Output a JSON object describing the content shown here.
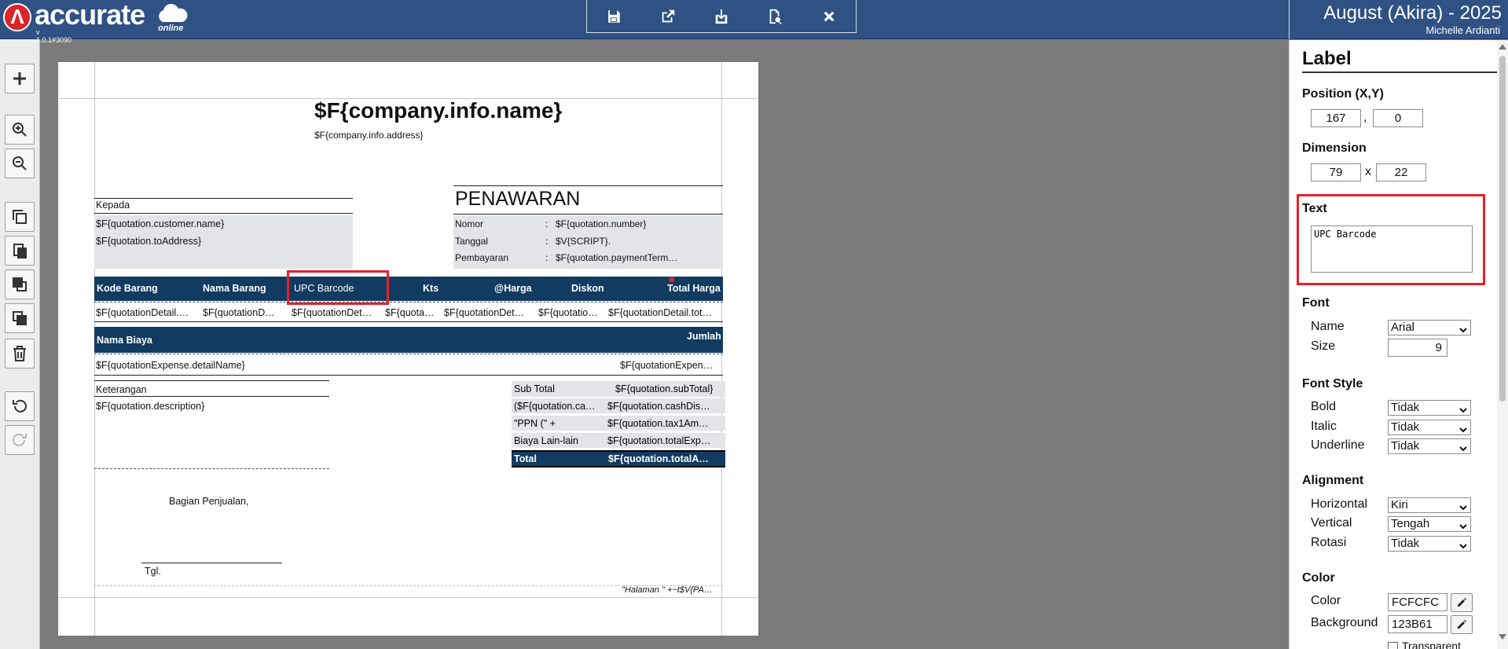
{
  "header": {
    "logo_text": "accurate",
    "logo_online": "online",
    "logo_version": "v 1.0.1#3090",
    "period_title": "August (Akira) - 2025",
    "user_name": "Michelle Ardianti"
  },
  "toolbar_top": {
    "icons": [
      "save-icon",
      "export-icon",
      "import-icon",
      "preview-icon",
      "close-icon"
    ]
  },
  "left_toolbar": {
    "icons": [
      "add-icon",
      "zoom-in-icon",
      "zoom-out-icon",
      "copy-icon",
      "paste-icon",
      "bring-front-icon",
      "send-back-icon",
      "delete-icon",
      "undo-icon",
      "redo-icon"
    ]
  },
  "report": {
    "company_name": "$F{company.info.name}",
    "company_address": "$F{company.info.address}",
    "kepada_label": "Kepada",
    "customer_name": "$F{quotation.customer.name}",
    "to_address": "$F{quotation.toAddress}",
    "doc_title": "PENAWARAN",
    "nomor_label": "Nomor",
    "nomor_value": "$F{quotation.number}",
    "tanggal_label": "Tanggal",
    "tanggal_value": "$V{SCRIPT}.",
    "pembayaran_label": "Pembayaran",
    "pembayaran_value": "$F{quotation.paymentTerm…",
    "colon": ":",
    "item_headers": [
      "Kode Barang",
      "Nama Barang",
      "UPC Barcode",
      "Kts",
      "@Harga",
      "Diskon",
      "Total Harga"
    ],
    "item_cells": [
      "$F{quotationDetail.…",
      "$F{quotationD…",
      "$F{quotationDet…",
      "$F{quota…",
      "$F{quotationDet…",
      "$F{quotatio…",
      "$F{quotationDetail.tot…"
    ],
    "expense_header": "Nama Biaya",
    "expense_amount_header": "Jumlah",
    "expense_name": "$F{quotationExpense.detailName}",
    "expense_amount": "$F{quotationExpen…",
    "keterangan_label": "Keterangan",
    "description": "$F{quotation.description}",
    "summary": [
      {
        "label": "Sub Total",
        "value": "$F{quotation.subTotal}"
      },
      {
        "label": "($F{quotation.ca…",
        "value": "$F{quotation.cashDis…"
      },
      {
        "label": "\"PPN (\" +",
        "value": "$F{quotation.tax1Am…"
      },
      {
        "label": "Biaya Lain-lain",
        "value": "$F{quotation.totalExp…"
      }
    ],
    "total_label": "Total",
    "total_value": "$F{quotation.totalA…",
    "bagian_penjualan": "Bagian Penjualan,",
    "tgl_label": "Tgl.",
    "page_footer": "\"Halaman \" +~t$V{PA…"
  },
  "panel": {
    "title": "Label",
    "position_label": "Position (X,Y)",
    "pos_x": "167",
    "pos_sep": ",",
    "pos_y": "0",
    "dimension_label": "Dimension",
    "dim_w": "79",
    "dim_sep": "x",
    "dim_h": "22",
    "text_label": "Text",
    "text_value": "UPC Barcode",
    "font_label": "Font",
    "font_name_label": "Name",
    "font_name_value": "Arial",
    "font_size_label": "Size",
    "font_size_value": "9",
    "font_style_label": "Font Style",
    "bold_label": "Bold",
    "bold_value": "Tidak",
    "italic_label": "Italic",
    "italic_value": "Tidak",
    "underline_label": "Underline",
    "underline_value": "Tidak",
    "alignment_label": "Alignment",
    "horizontal_label": "Horizontal",
    "horizontal_value": "Kiri",
    "vertical_label": "Vertical",
    "vertical_value": "Tengah",
    "rotasi_label": "Rotasi",
    "rotasi_value": "Tidak",
    "color_label": "Color",
    "color_field_label": "Color",
    "color_value": "FCFCFC",
    "background_label": "Background",
    "background_value": "123B61",
    "transparent_label": "Transparent"
  },
  "colors": {
    "header_bg": "#2f5183",
    "table_header_bg": "#123b61",
    "highlight": "#e3212b",
    "grey_fill": "#e3e4e8"
  }
}
